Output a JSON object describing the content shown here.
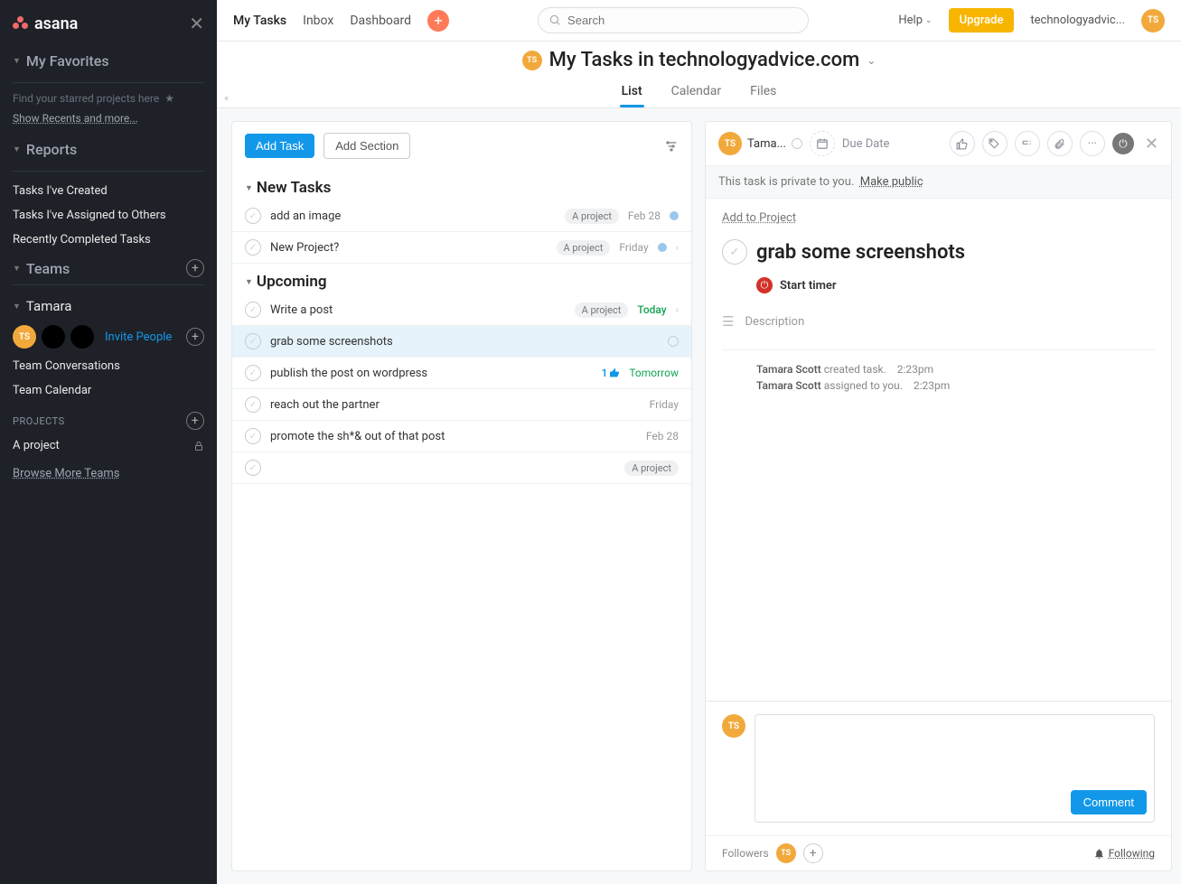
{
  "sidebar": {
    "logo": "asana",
    "favorites_heading": "My Favorites",
    "favorites_hint": "Find your starred projects here",
    "show_recents": "Show Recents and more...",
    "reports_heading": "Reports",
    "reports": [
      "Tasks I've Created",
      "Tasks I've Assigned to Others",
      "Recently Completed Tasks"
    ],
    "teams_heading": "Teams",
    "team_name": "Tamara",
    "invite": "Invite People",
    "team_links": [
      "Team Conversations",
      "Team Calendar"
    ],
    "projects_heading": "PROJECTS",
    "project": "A project",
    "browse_more": "Browse More Teams"
  },
  "topbar": {
    "nav": [
      "My Tasks",
      "Inbox",
      "Dashboard"
    ],
    "search_placeholder": "Search",
    "help": "Help",
    "upgrade": "Upgrade",
    "org": "technologyadvic...",
    "avatar": "TS"
  },
  "page": {
    "title": "My Tasks in technologyadvice.com",
    "avatar": "TS",
    "tabs": [
      "List",
      "Calendar",
      "Files"
    ]
  },
  "toolbar": {
    "add_task": "Add Task",
    "add_section": "Add Section"
  },
  "sections": {
    "new_tasks": "New Tasks",
    "upcoming": "Upcoming"
  },
  "tasks": {
    "new": [
      {
        "title": "add an image",
        "project": "A project",
        "due": "Feb 28",
        "color": "blue"
      },
      {
        "title": "New Project?",
        "project": "A project",
        "due": "Friday",
        "color": "blue"
      }
    ],
    "upcoming": [
      {
        "title": "Write a post",
        "project": "A project",
        "due": "Today",
        "due_style": "today",
        "caret": true
      },
      {
        "title": "grab some screenshots",
        "selected": true
      },
      {
        "title": "publish the post on wordpress",
        "due": "Tomorrow",
        "due_style": "tomorrow",
        "likes": "1"
      },
      {
        "title": "reach out the partner",
        "due": "Friday"
      },
      {
        "title": "promote the sh*& out of that post",
        "due": "Feb 28"
      },
      {
        "title": "",
        "project": "A project"
      }
    ]
  },
  "detail": {
    "assignee_avatar": "TS",
    "assignee_name": "Tama...",
    "due_date_label": "Due Date",
    "private_text": "This task is private to you.",
    "make_public": "Make public",
    "add_to_project": "Add to Project",
    "title": "grab some screenshots",
    "start_timer": "Start timer",
    "description_placeholder": "Description",
    "activity": [
      {
        "who": "Tamara Scott",
        "action": "created task.",
        "time": "2:23pm"
      },
      {
        "who": "Tamara Scott",
        "action": "assigned to you.",
        "time": "2:23pm"
      }
    ],
    "comment_button": "Comment",
    "followers_label": "Followers",
    "following": "Following"
  }
}
